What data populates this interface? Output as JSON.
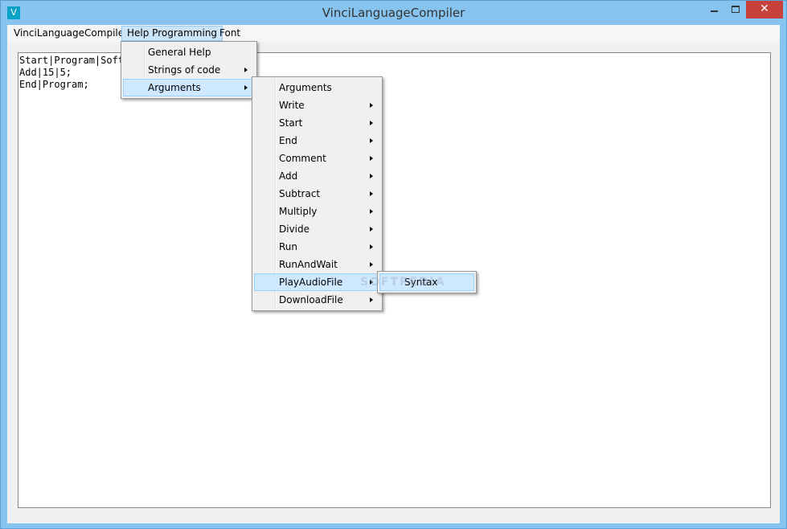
{
  "window": {
    "title": "VinciLanguageCompiler",
    "icon_letter": "V",
    "min_glyph": "",
    "close_glyph": "✕"
  },
  "menubar": [
    "VinciLanguageCompiler",
    "Help Programming",
    "Font"
  ],
  "editor": {
    "lines": [
      "Start|Program|Soft",
      "Add|15|5;",
      "End|Program;"
    ]
  },
  "help_menu": {
    "items": [
      {
        "label": "General Help",
        "submenu": false
      },
      {
        "label": "Strings of code",
        "submenu": true
      },
      {
        "label": "Arguments",
        "submenu": true
      }
    ]
  },
  "arguments_menu": {
    "items": [
      {
        "label": "Arguments",
        "submenu": false
      },
      {
        "label": "Write",
        "submenu": true
      },
      {
        "label": "Start",
        "submenu": true
      },
      {
        "label": "End",
        "submenu": true
      },
      {
        "label": "Comment",
        "submenu": true
      },
      {
        "label": "Add",
        "submenu": true
      },
      {
        "label": "Subtract",
        "submenu": true
      },
      {
        "label": "Multiply",
        "submenu": true
      },
      {
        "label": "Divide",
        "submenu": true
      },
      {
        "label": "Run",
        "submenu": true
      },
      {
        "label": "RunAndWait",
        "submenu": true
      },
      {
        "label": "PlayAudioFile",
        "submenu": true
      },
      {
        "label": "DownloadFile",
        "submenu": true
      }
    ]
  },
  "playaudio_menu": {
    "items": [
      {
        "label": "Syntax"
      }
    ]
  },
  "watermark": "SOFTPEDIA",
  "colors": {
    "titlebar": "#87c3ef",
    "close": "#c7423b",
    "highlight": "#cde8ff",
    "icon": "#0aa3c7"
  }
}
